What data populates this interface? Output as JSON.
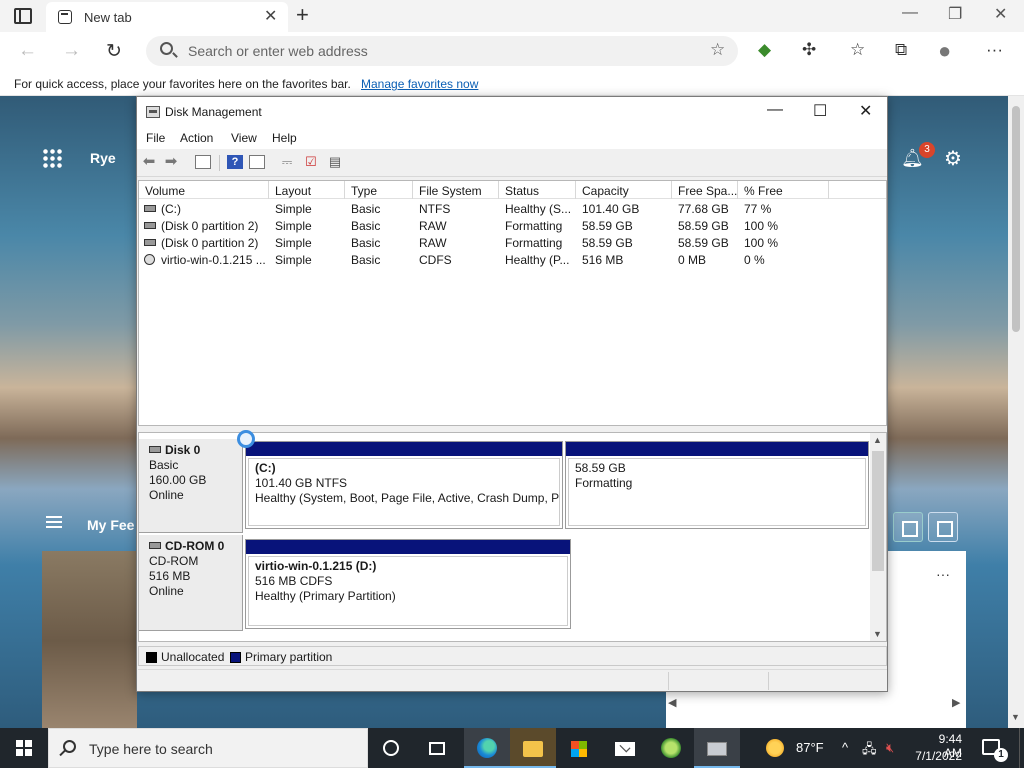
{
  "browser": {
    "tab_title": "New tab",
    "address_placeholder": "Search or enter web address",
    "favbar_text": "For quick access, place your favorites here on the favorites bar.",
    "favbar_link": "Manage favorites now"
  },
  "newtab": {
    "weather_location": "Rye",
    "notification_count": "3",
    "feed_title": "My Fee",
    "card_more": "···"
  },
  "disk_management": {
    "title": "Disk Management",
    "menu": [
      "File",
      "Action",
      "View",
      "Help"
    ],
    "columns": [
      "Volume",
      "Layout",
      "Type",
      "File System",
      "Status",
      "Capacity",
      "Free Spa...",
      "% Free"
    ],
    "volumes": [
      {
        "volume": "(C:)",
        "layout": "Simple",
        "type": "Basic",
        "fs": "NTFS",
        "status": "Healthy (S...",
        "capacity": "101.40 GB",
        "free": "77.68 GB",
        "pct": "77 %",
        "icon": "drive-icon"
      },
      {
        "volume": "(Disk 0 partition 2)",
        "layout": "Simple",
        "type": "Basic",
        "fs": "RAW",
        "status": "Formatting",
        "capacity": "58.59 GB",
        "free": "58.59 GB",
        "pct": "100 %",
        "icon": "drive-icon"
      },
      {
        "volume": "(Disk 0 partition 2)",
        "layout": "Simple",
        "type": "Basic",
        "fs": "RAW",
        "status": "Formatting",
        "capacity": "58.59 GB",
        "free": "58.59 GB",
        "pct": "100 %",
        "icon": "drive-icon"
      },
      {
        "volume": "virtio-win-0.1.215 ...",
        "layout": "Simple",
        "type": "Basic",
        "fs": "CDFS",
        "status": "Healthy (P...",
        "capacity": "516 MB",
        "free": "0 MB",
        "pct": "0 %",
        "icon": "cd-icon"
      }
    ],
    "disks": [
      {
        "name": "Disk 0",
        "kind": "Basic",
        "size": "160.00 GB",
        "state": "Online",
        "partitions": [
          {
            "label": "(C:)",
            "line2": "101.40 GB NTFS",
            "line3": "Healthy (System, Boot, Page File, Active, Crash Dump, Primary Partition)"
          },
          {
            "label": "",
            "line2": "58.59 GB",
            "line3": "Formatting"
          }
        ]
      },
      {
        "name": "CD-ROM 0",
        "kind": "CD-ROM",
        "size": "516 MB",
        "state": "Online",
        "partitions": [
          {
            "label": "virtio-win-0.1.215  (D:)",
            "line2": "516 MB CDFS",
            "line3": "Healthy (Primary Partition)"
          }
        ]
      }
    ],
    "legend": [
      {
        "label": "Unallocated",
        "color": "#000000"
      },
      {
        "label": "Primary partition",
        "color": "#08137a"
      }
    ]
  },
  "taskbar": {
    "search_placeholder": "Type here to search",
    "temperature": "87°F",
    "time": "9:44 AM",
    "date": "7/1/2022",
    "notification_count": "1"
  },
  "colors": {
    "partition_bar": "#08137a",
    "taskbar": "#20262c",
    "link": "#0b5fb5"
  }
}
